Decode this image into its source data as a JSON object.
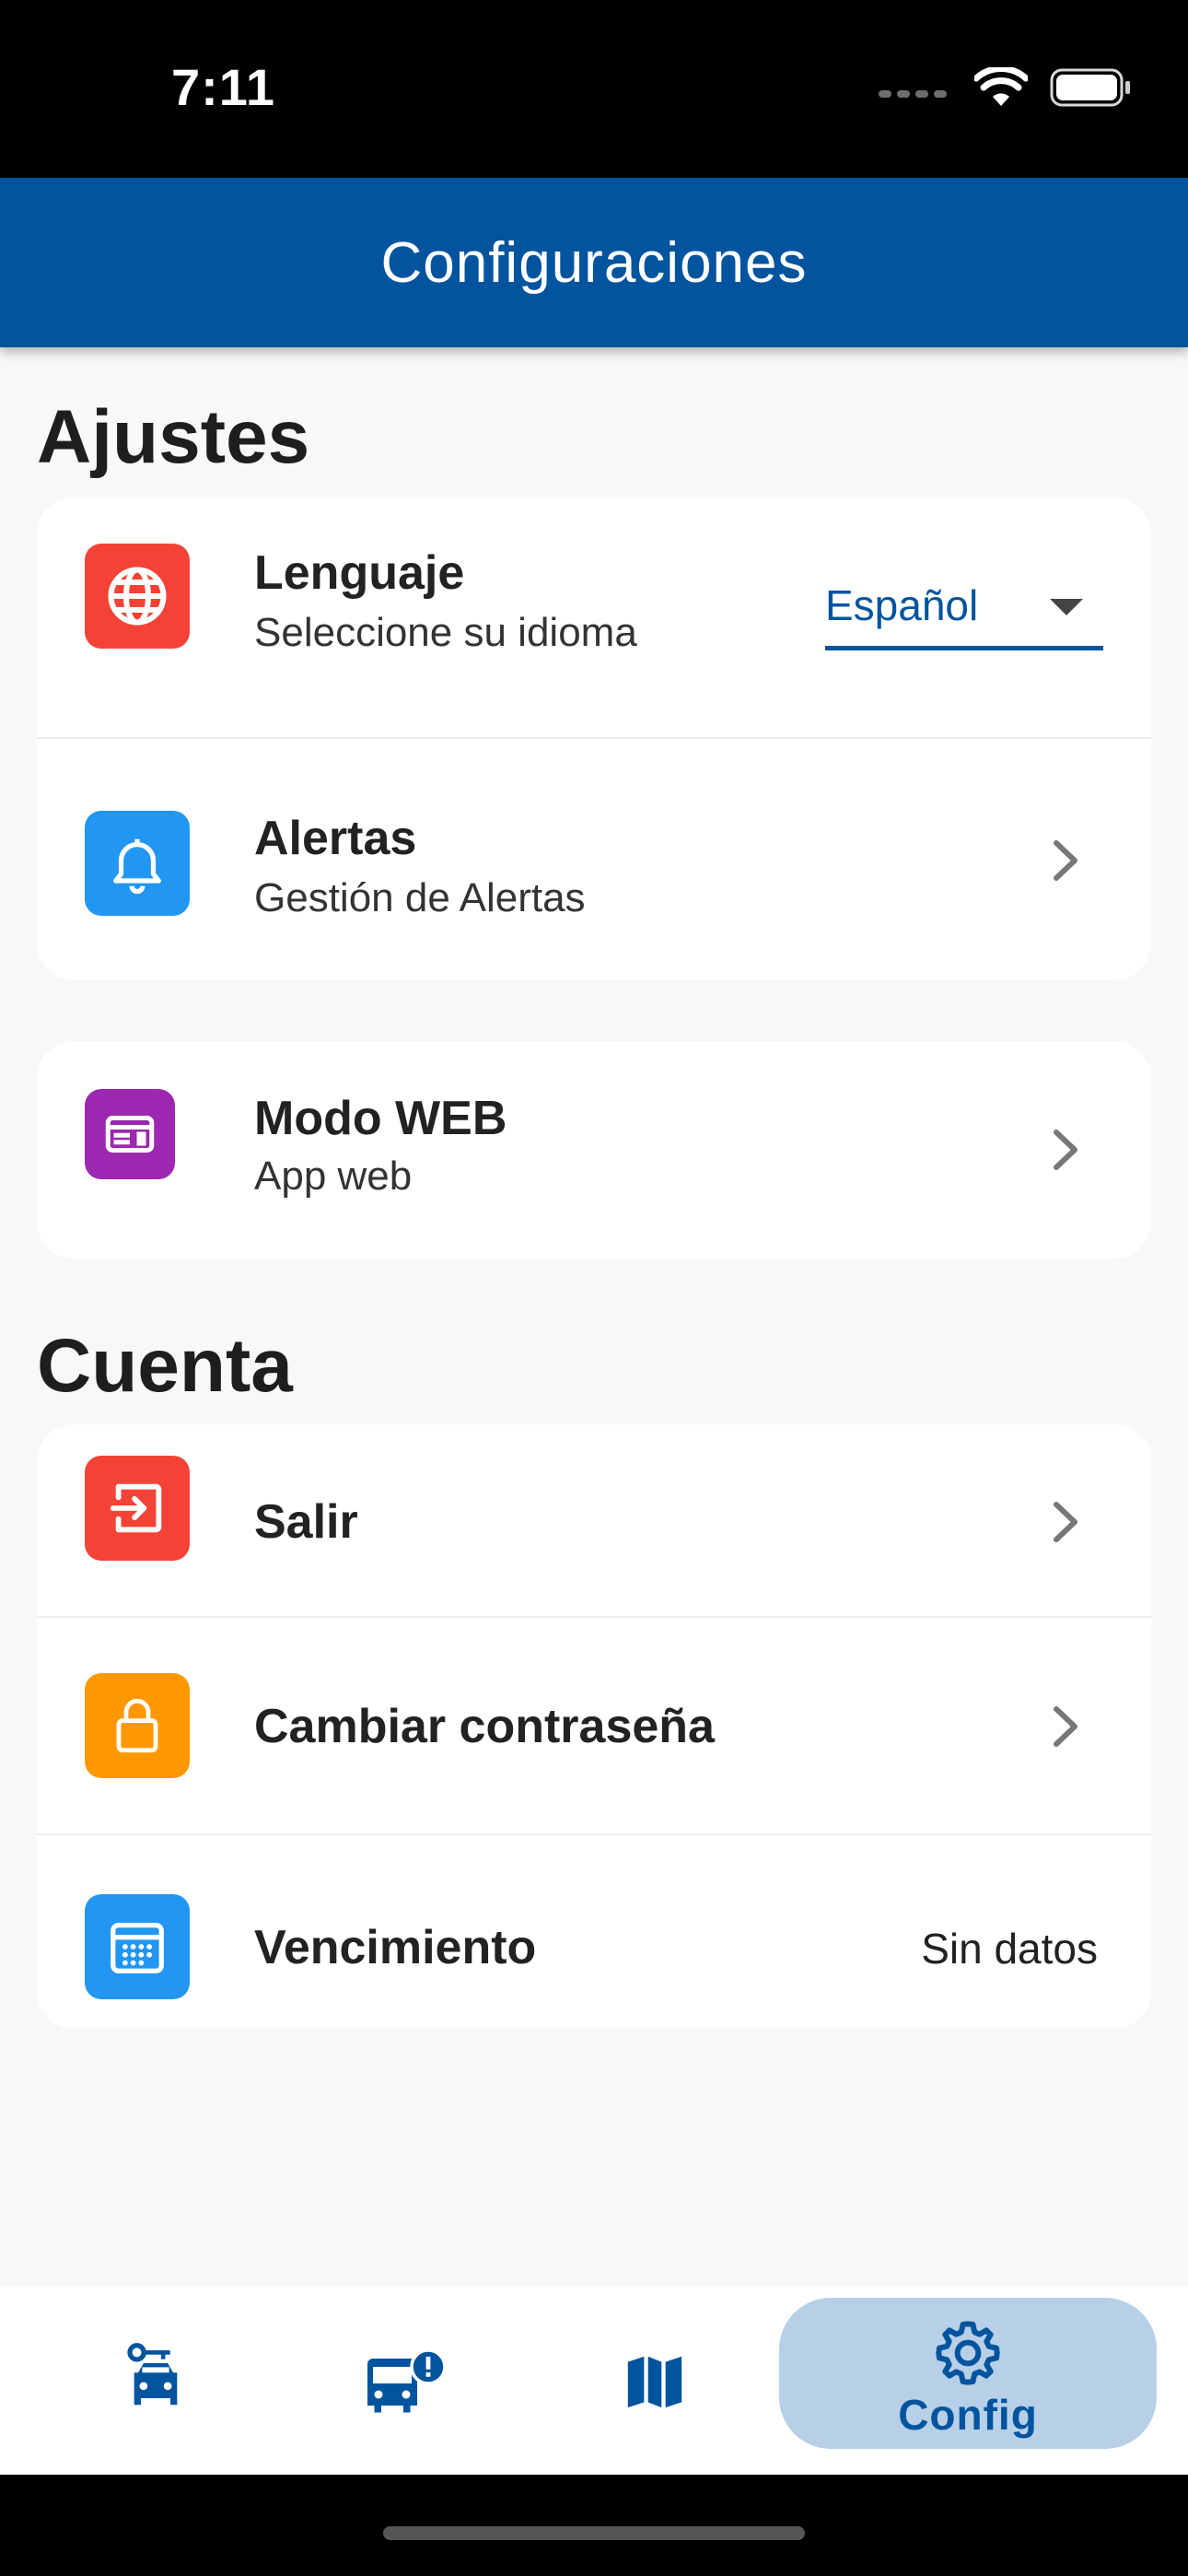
{
  "status_bar": {
    "time": "7:11"
  },
  "app_bar": {
    "title": "Configuraciones"
  },
  "sections": {
    "settings_title": "Ajustes",
    "account_title": "Cuenta"
  },
  "settings": {
    "language": {
      "title": "Lenguaje",
      "subtitle": "Seleccione su idioma",
      "selected": "Español"
    },
    "alerts": {
      "title": "Alertas",
      "subtitle": "Gestión de Alertas"
    },
    "web_mode": {
      "title": "Modo WEB",
      "subtitle": "App web"
    }
  },
  "account": {
    "logout": {
      "title": "Salir"
    },
    "change_password": {
      "title": "Cambiar contraseña"
    },
    "expiration": {
      "title": "Vencimiento",
      "value": "Sin datos"
    }
  },
  "bottom_nav": {
    "items": [
      {
        "icon": "car-key-icon"
      },
      {
        "icon": "bus-alert-icon"
      },
      {
        "icon": "map-icon"
      },
      {
        "icon": "gear-icon",
        "label": "Config",
        "active": true
      }
    ]
  },
  "colors": {
    "primary": "#02549e",
    "language_icon": "#f44336",
    "alerts_icon": "#2196f3",
    "web_icon": "#9c27b0",
    "logout_icon": "#f44336",
    "password_icon": "#ff9800",
    "expiration_icon": "#2196f3",
    "nav_active_bg": "#b7d0e8"
  }
}
